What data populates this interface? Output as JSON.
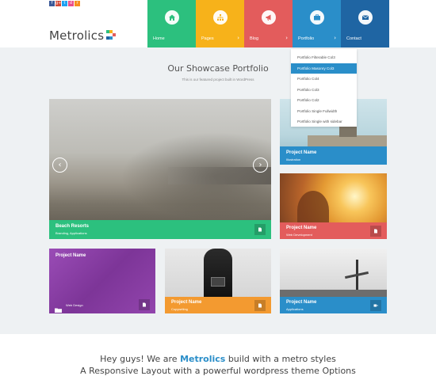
{
  "header": {
    "logo": "Metrolics",
    "socials": [
      "f",
      "g+",
      "t",
      "d",
      "r"
    ]
  },
  "nav": [
    {
      "label": "Home",
      "color": "#2cc07e",
      "icon": "home-icon",
      "has_arrow": false
    },
    {
      "label": "Pages",
      "color": "#f7b21a",
      "icon": "sitemap-icon",
      "has_arrow": true
    },
    {
      "label": "Blog",
      "color": "#e35c5c",
      "icon": "megaphone-icon",
      "has_arrow": true
    },
    {
      "label": "Portfolio",
      "color": "#2a8ec9",
      "icon": "briefcase-icon",
      "has_arrow": true
    },
    {
      "label": "Contact",
      "color": "#1f65a3",
      "icon": "envelope-icon",
      "has_arrow": false
    }
  ],
  "dropdown": [
    "Portfolio Filterable Col3",
    "Portfolio Masonry Col3",
    "Portfolio Col4",
    "Portfolio Col3",
    "Portfolio Col2",
    "Portfolio Single Fullwidth",
    "Portfolio Single with sidebar"
  ],
  "dropdown_active": 1,
  "showcase": {
    "title": "Our Showcase Portfolio",
    "subtitle": "This is our featured project built in WordPress"
  },
  "tiles": {
    "beach": {
      "title": "Beach Resorts",
      "sub": "Branding, Applications"
    },
    "tr1": {
      "title": "Project Name",
      "sub": "Illustration"
    },
    "tr2": {
      "title": "Project Name",
      "sub": "Web Development"
    },
    "b1": {
      "title": "Project Name",
      "sub": "Web Design"
    },
    "b2": {
      "title": "Project Name",
      "sub": "Copywriting"
    },
    "b3": {
      "title": "Project Name",
      "sub": "Applications"
    }
  },
  "intro": {
    "prefix": "Hey guys! We are ",
    "brand": "Metrolics",
    "suffix": " build with a metro styles",
    "line2": "A Responsive Layout with a powerful wordpress theme Options"
  },
  "colors": {
    "green": "#2cc07e",
    "yellow": "#f7b21a",
    "red": "#e35c5c",
    "blue": "#2a8ec9",
    "darkblue": "#1f65a3",
    "purple": "#8b3fa7",
    "orange": "#f39a30"
  }
}
